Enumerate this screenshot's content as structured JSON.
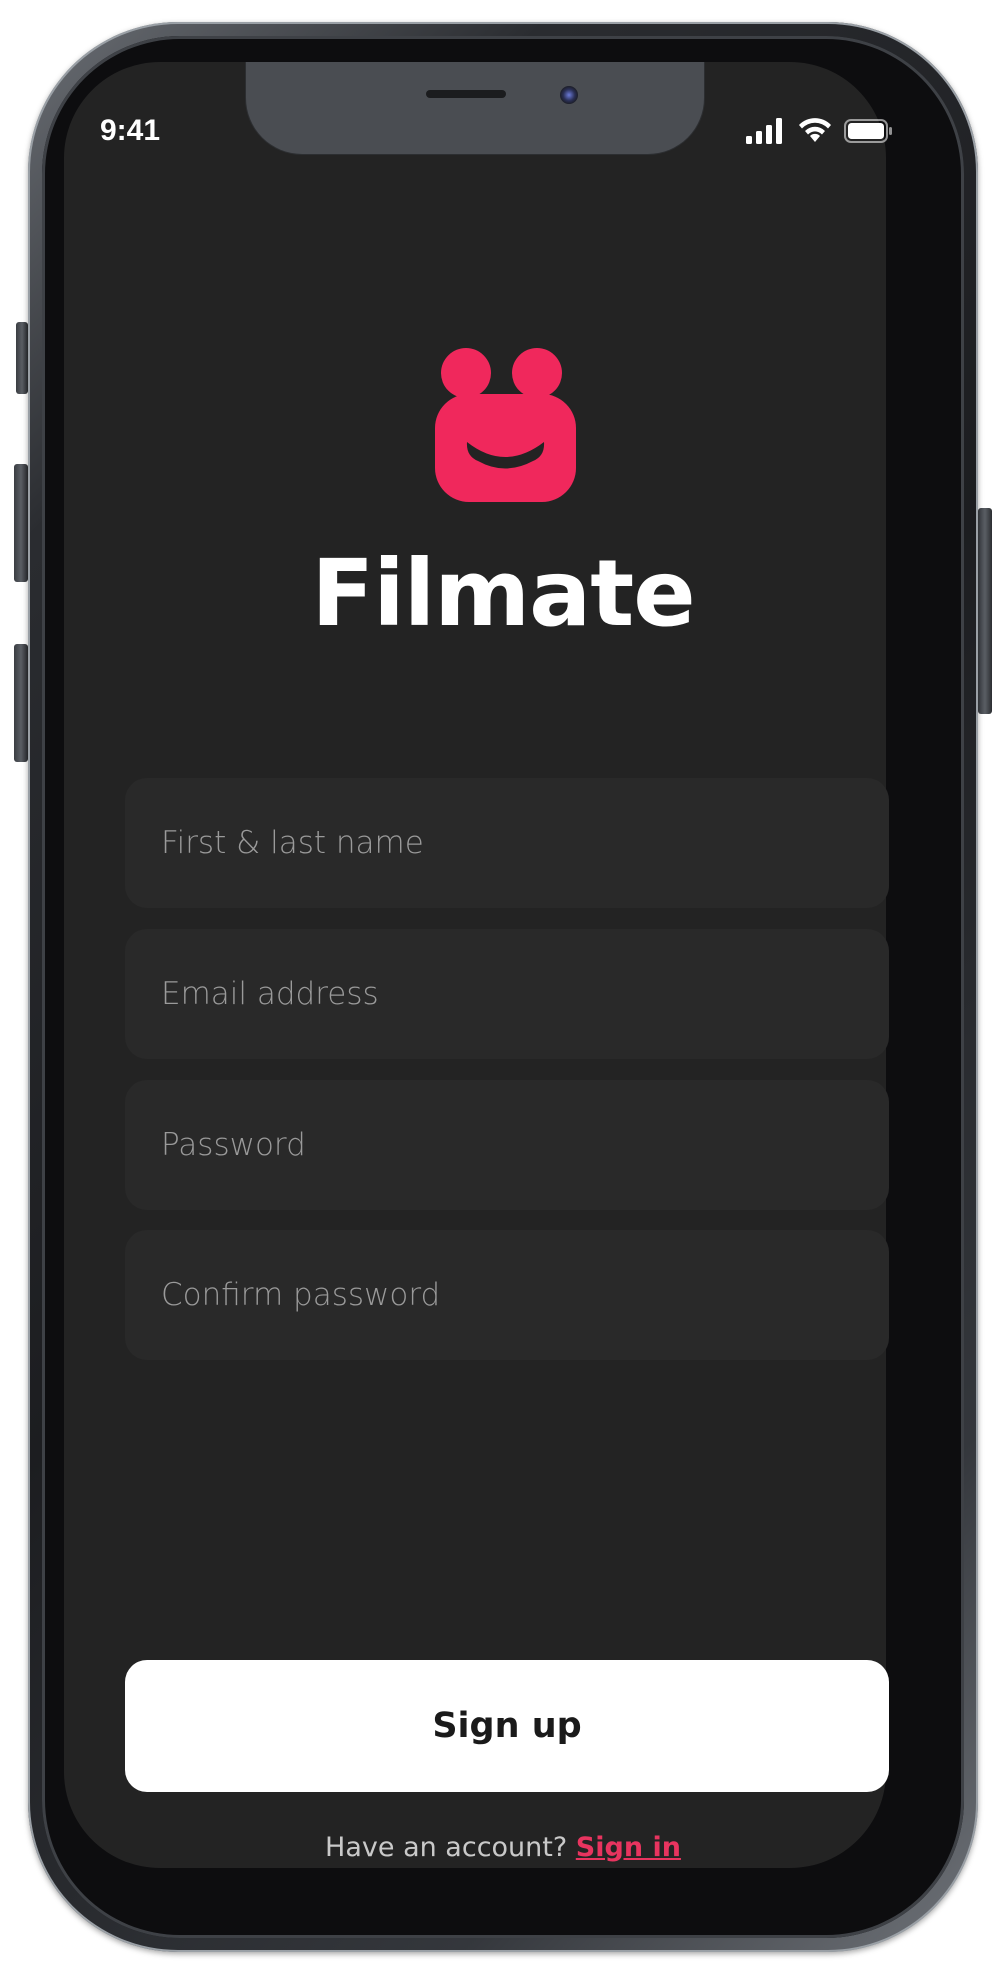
{
  "status_bar": {
    "time": "9:41",
    "icons": [
      "signal-icon",
      "wifi-icon",
      "battery-icon"
    ]
  },
  "brand": {
    "logo_icon": "smiley-logo-icon",
    "name": "Filmate",
    "accent_color": "#f0285c"
  },
  "form": {
    "name_placeholder": "First & last name",
    "email_placeholder": "Email address",
    "password_placeholder": "Password",
    "confirm_placeholder": "Confirm password"
  },
  "actions": {
    "signup_label": "Sign up"
  },
  "footer": {
    "prompt": "Have an account? ",
    "signin_label": "Sign in"
  }
}
